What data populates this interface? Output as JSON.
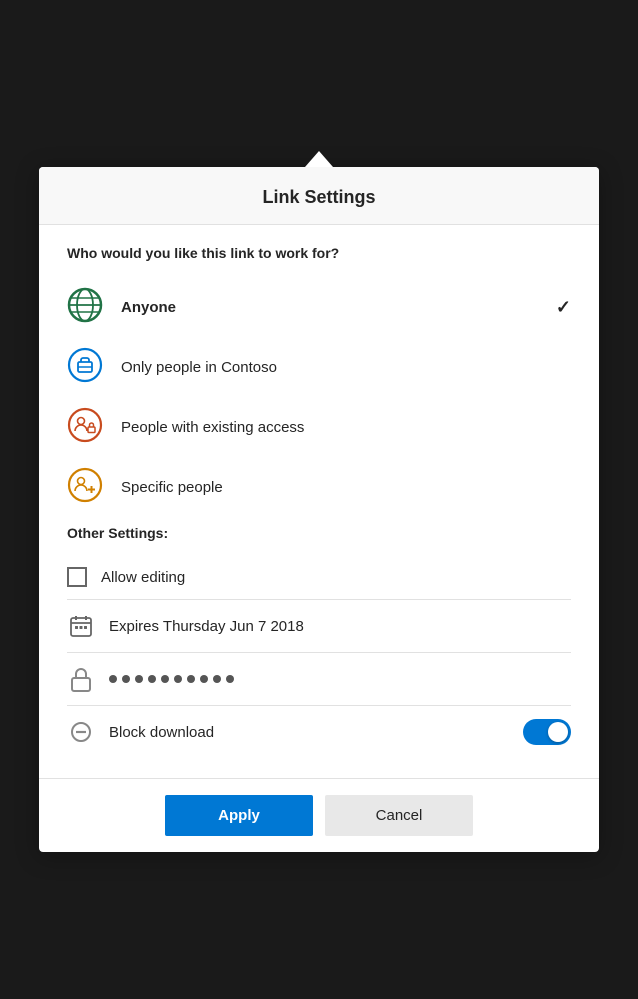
{
  "modal": {
    "title": "Link Settings",
    "caret": true
  },
  "link_section": {
    "question": "Who would you like this link to work for?",
    "options": [
      {
        "id": "anyone",
        "label": "Anyone",
        "bold": true,
        "selected": true,
        "icon_type": "globe",
        "icon_color": "#217346"
      },
      {
        "id": "contoso",
        "label": "Only people in Contoso",
        "bold": false,
        "selected": false,
        "icon_type": "building",
        "icon_color": "#0078d4"
      },
      {
        "id": "existing",
        "label": "People with existing access",
        "bold": false,
        "selected": false,
        "icon_type": "people-lock",
        "icon_color": "#c84b1e"
      },
      {
        "id": "specific",
        "label": "Specific people",
        "bold": false,
        "selected": false,
        "icon_type": "people-plus",
        "icon_color": "#d08000"
      }
    ]
  },
  "other_settings": {
    "label": "Other Settings:",
    "rows": [
      {
        "id": "allow-editing",
        "type": "checkbox",
        "label": "Allow editing",
        "checked": false
      },
      {
        "id": "expires",
        "type": "date",
        "label": "Expires Thursday Jun 7 2018"
      },
      {
        "id": "password",
        "type": "password",
        "dots": 10
      },
      {
        "id": "block-download",
        "type": "toggle",
        "label": "Block download",
        "enabled": true
      }
    ]
  },
  "footer": {
    "apply_label": "Apply",
    "cancel_label": "Cancel"
  }
}
